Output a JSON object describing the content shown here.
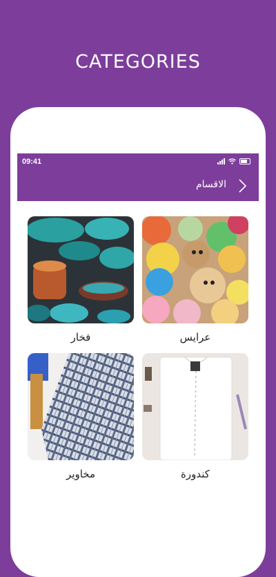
{
  "promo": {
    "title": "CATEGORIES"
  },
  "status_bar": {
    "time": "09:41"
  },
  "app_bar": {
    "title": "الاقسام",
    "back_icon": "chevron-right-icon"
  },
  "categories": [
    {
      "label": "عرايس",
      "image": "plush-toys-photo"
    },
    {
      "label": "فخار",
      "image": "pottery-photo"
    },
    {
      "label": "كندورة",
      "image": "white-kandura-photo"
    },
    {
      "label": "مخاوير",
      "image": "plaid-fabric-photo"
    }
  ],
  "colors": {
    "brand_purple": "#7d3e9b",
    "background": "#ffffff"
  }
}
